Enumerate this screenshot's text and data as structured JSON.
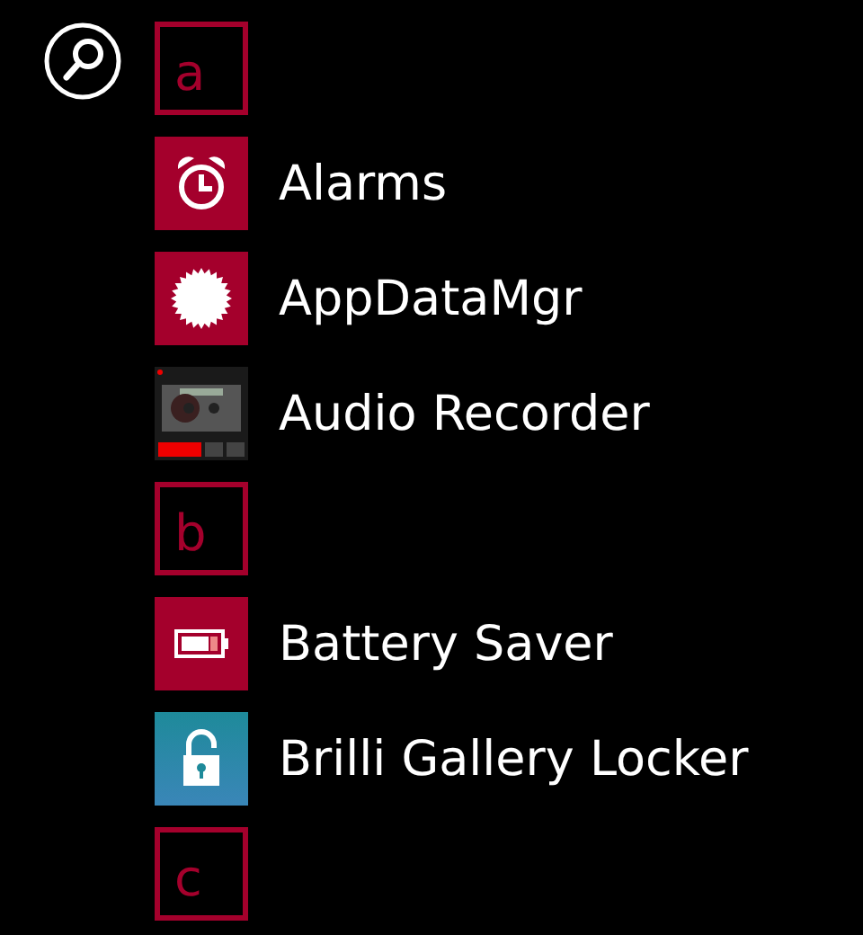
{
  "items": [
    {
      "kind": "letter",
      "text": "a"
    },
    {
      "kind": "alarm",
      "name": "Alarms",
      "color": "#a4002c"
    },
    {
      "kind": "starburst",
      "name": "AppDataMgr",
      "color": "#a4002c"
    },
    {
      "kind": "recorder",
      "name": "Audio Recorder",
      "color": "#1a1a1a"
    },
    {
      "kind": "letter",
      "text": "b"
    },
    {
      "kind": "battery",
      "name": "Battery Saver",
      "color": "#a4002c"
    },
    {
      "kind": "padlock",
      "name": "Brilli Gallery Locker",
      "color": "#1e8a9a"
    },
    {
      "kind": "letter",
      "text": "c"
    }
  ]
}
